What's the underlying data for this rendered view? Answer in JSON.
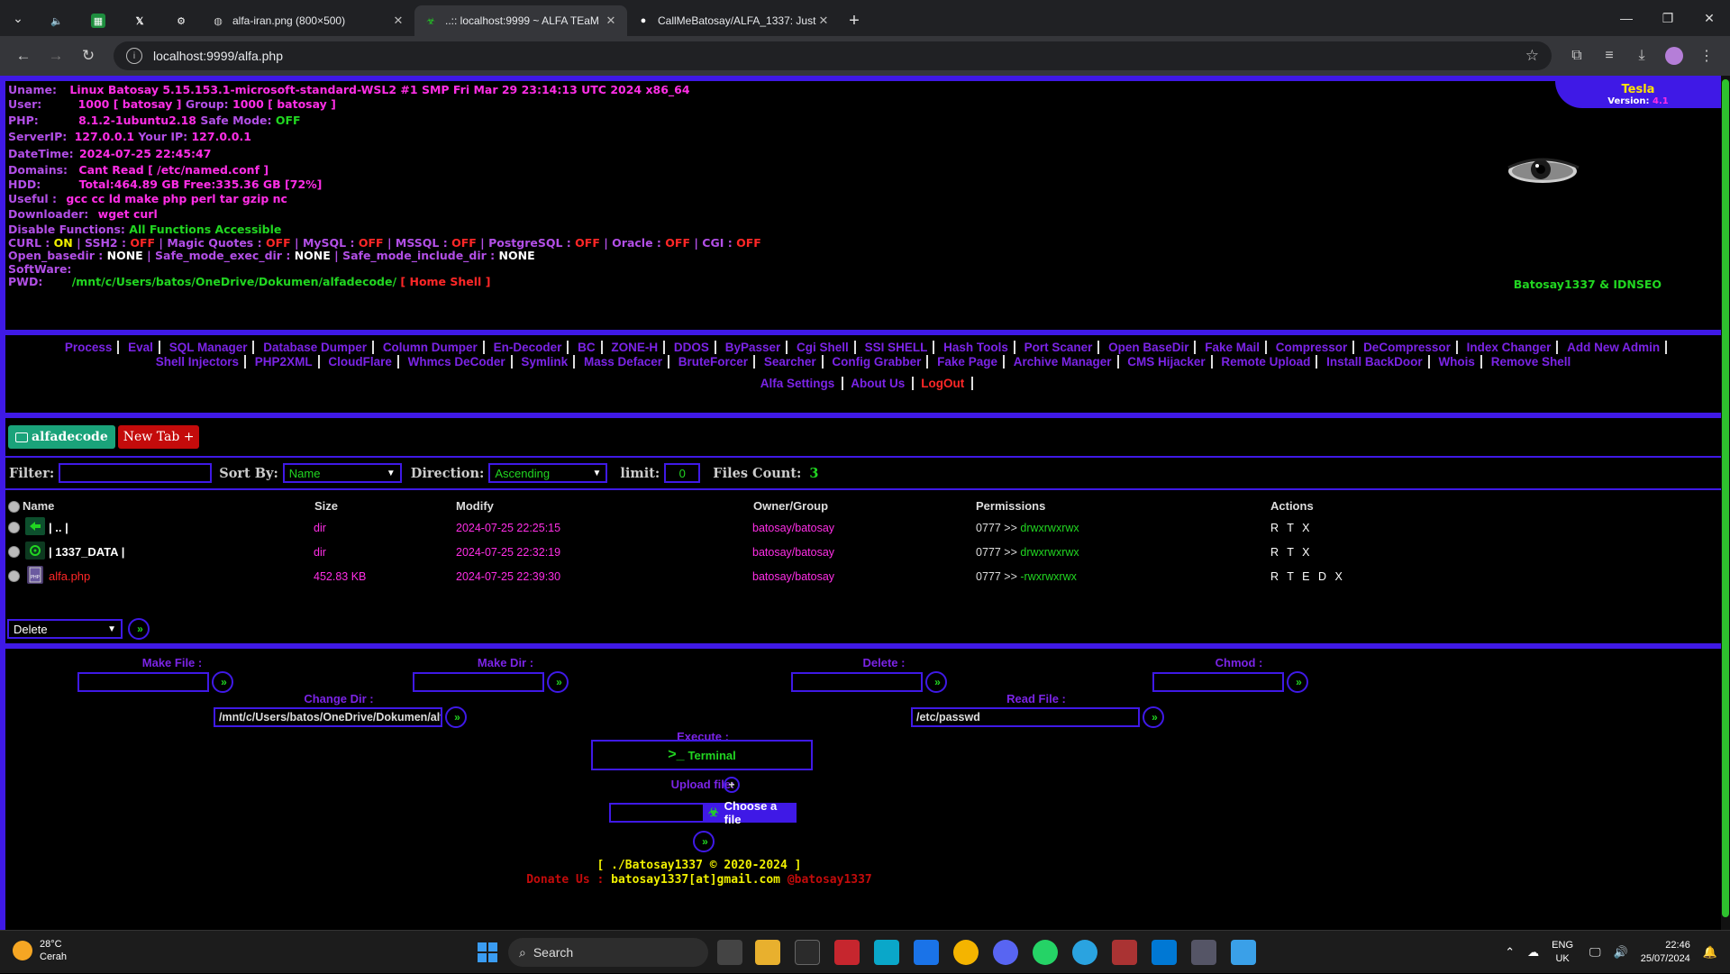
{
  "browser": {
    "tabs": [
      {
        "title": "",
        "fav": "dropdown-icon"
      },
      {
        "title": "",
        "fav": "volume-icon"
      },
      {
        "title": "",
        "fav": "sheets-icon"
      },
      {
        "title": "",
        "fav": "x-icon"
      },
      {
        "title": "",
        "fav": "chatgpt-icon"
      },
      {
        "title": "alfa-iran.png (800×500)",
        "fav": "globe-icon"
      },
      {
        "title": "..:: localhost:9999 ~ ALFA TEaM",
        "fav": "alfa-icon"
      },
      {
        "title": "CallMeBatosay/ALFA_1337: Just",
        "fav": "github-icon"
      }
    ],
    "url": "localhost:9999/alfa.php"
  },
  "info": {
    "uname_label": "Uname:",
    "uname": "Linux Batosay 5.15.153.1-microsoft-standard-WSL2 #1 SMP Fri Mar 29 23:14:13 UTC 2024 x86_64",
    "user_label": "User:",
    "user": "1000 [ batosay ]",
    "group_label": "Group:",
    "group": "1000 [ batosay ]",
    "php_label": "PHP:",
    "php": "8.1.2-1ubuntu2.18",
    "safe_label": "Safe Mode:",
    "safe": "OFF",
    "serverip_label": "ServerIP:",
    "serverip": "127.0.0.1",
    "yourip_label": "Your IP:",
    "yourip": "127.0.0.1",
    "datetime_label": "DateTime:",
    "datetime": "2024-07-25 22:45:47",
    "domains_label": "Domains:",
    "domains": "Cant Read [ /etc/named.conf ]",
    "hdd_label": "HDD:",
    "hdd": "Total:464.89 GB Free:335.36 GB [72%]",
    "useful_label": "Useful :",
    "useful": "gcc cc ld make php perl tar gzip nc",
    "downloader_label": "Downloader:",
    "downloader": "wget curl",
    "disable_label": "Disable Functions:",
    "disable": "All Functions Accessible",
    "curl_label": "CURL :",
    "curl": "ON",
    "ssh2_label": "SSH2 :",
    "ssh2": "OFF",
    "magic_label": "Magic Quotes :",
    "magic": "OFF",
    "mysql_label": "MySQL :",
    "mysql": "OFF",
    "mssql_label": "MSSQL :",
    "mssql": "OFF",
    "pgsql_label": "PostgreSQL :",
    "pgsql": "OFF",
    "oracle_label": "Oracle :",
    "oracle": "OFF",
    "cgi_label": "CGI :",
    "cgi": "OFF",
    "openbase_label": "Open_basedir :",
    "openbase": "NONE",
    "safeexec_label": "Safe_mode_exec_dir :",
    "safeexec": "NONE",
    "safeinc_label": "Safe_mode_include_dir :",
    "safeinc": "NONE",
    "software_label": "SoftWare:",
    "pwd_label": "PWD:",
    "pwd": "/mnt/c/Users/batos/OneDrive/Dokumen/alfadecode/",
    "home_shell": "[ Home Shell ]",
    "brand": "Tesla",
    "version_label": "Version:",
    "version": "4.1",
    "team": "Batosay1337 & IDNSEO",
    "eye": "eye-icon"
  },
  "menu": {
    "links": [
      "Process",
      "Eval",
      "SQL Manager",
      "Database Dumper",
      "Column Dumper",
      "En-Decoder",
      "BC",
      "ZONE-H",
      "DDOS",
      "ByPasser",
      "Cgi Shell",
      "SSI SHELL",
      "Hash Tools",
      "Port Scaner",
      "Open BaseDir",
      "Fake Mail",
      "Compressor",
      "DeCompressor",
      "Index Changer",
      "Add New Admin",
      "Shell Injectors",
      "PHP2XML",
      "CloudFlare",
      "Whmcs DeCoder",
      "Symlink",
      "Mass Defacer",
      "BruteForcer",
      "Searcher",
      "Config Grabber",
      "Fake Page",
      "Archive Manager",
      "CMS Hijacker",
      "Remote Upload",
      "Install BackDoor",
      "Whois",
      "Remove Shell"
    ],
    "settings": "Alfa Settings",
    "about": "About Us",
    "logout": "LogOut"
  },
  "tabsbar": {
    "dir_tab": "alfadecode",
    "new_tab": "New Tab +"
  },
  "filter": {
    "filter_label": "Filter:",
    "sort_label": "Sort By:",
    "sort_value": "Name",
    "direction_label": "Direction:",
    "direction_value": "Ascending",
    "limit_label": "limit:",
    "limit_value": "0",
    "count_label": "Files Count:",
    "count": "3"
  },
  "table": {
    "headers": {
      "name": "Name",
      "size": "Size",
      "modify": "Modify",
      "owner": "Owner/Group",
      "perms": "Permissions",
      "actions": "Actions"
    },
    "rows": [
      {
        "name": "| .. |",
        "size": "dir",
        "modify": "2024-07-25 22:25:15",
        "owner": "batosay/batosay",
        "perm_octal": "0777 >>",
        "perm": "drwxrwxrwx",
        "actions": "R T X"
      },
      {
        "name": "| 1337_DATA |",
        "size": "dir",
        "modify": "2024-07-25 22:32:19",
        "owner": "batosay/batosay",
        "perm_octal": "0777 >>",
        "perm": "drwxrwxrwx",
        "actions": "R T X"
      },
      {
        "name": "alfa.php",
        "size": "452.83 KB",
        "modify": "2024-07-25 22:39:30",
        "owner": "batosay/batosay",
        "perm_octal": "0777 >>",
        "perm": "-rwxrwxrwx",
        "actions": "R T E D X"
      }
    ],
    "bulk_action": "Delete"
  },
  "tools": {
    "make_file": "Make File :",
    "make_dir": "Make Dir :",
    "delete": "Delete :",
    "chmod": "Chmod :",
    "change_dir": "Change Dir :",
    "change_dir_value": "/mnt/c/Users/batos/OneDrive/Dokumen/alfadecode",
    "read_file": "Read File :",
    "read_file_value": "/etc/passwd",
    "execute": "Execute :",
    "terminal": "Terminal",
    "upload": "Upload file:",
    "choose": "Choose a file",
    "footer1": "[ ./Batosay1337 © 2020-2024 ]",
    "footer2_pre": "Donate Us :",
    "footer2_mail": "batosay1337[at]gmail.com",
    "footer2_post": "@batosay1337"
  },
  "taskbar": {
    "temp": "28°C",
    "weather": "Cerah",
    "search": "Search",
    "lang1": "ENG",
    "lang2": "UK",
    "time": "22:46",
    "date": "25/07/2024"
  },
  "colors": {
    "accent": "#3f19e6",
    "green": "#21d621",
    "magenta": "#ff2ee6",
    "red": "#ff2727",
    "purple": "#7b24e6"
  }
}
